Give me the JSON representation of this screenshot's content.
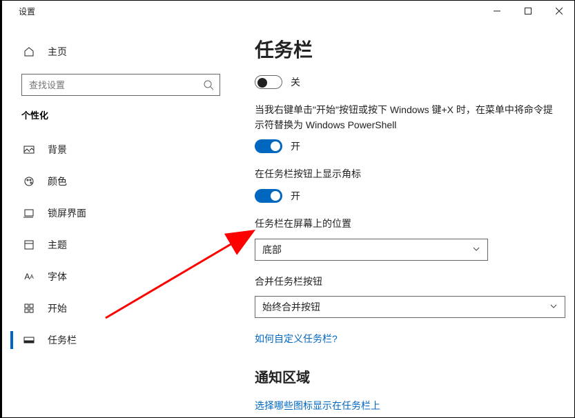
{
  "window": {
    "title": "设置"
  },
  "nav": {
    "home": "主页",
    "search_placeholder": "查找设置",
    "section": "个性化",
    "items": [
      {
        "label": "背景"
      },
      {
        "label": "颜色"
      },
      {
        "label": "锁屏界面"
      },
      {
        "label": "主题"
      },
      {
        "label": "字体"
      },
      {
        "label": "开始"
      },
      {
        "label": "任务栏"
      }
    ]
  },
  "page": {
    "title": "任务栏",
    "toggle1": {
      "state": "off",
      "label": "关"
    },
    "desc1": "当我右键单击\"开始\"按钮或按下 Windows 键+X 时，在菜单中将命令提示符替换为 Windows PowerShell",
    "toggle2": {
      "state": "on",
      "label": "开"
    },
    "desc2": "在任务栏按钮上显示角标",
    "toggle3": {
      "state": "on",
      "label": "开"
    },
    "desc3": "任务栏在屏幕上的位置",
    "dropdown1": "底部",
    "desc4": "合并任务栏按钮",
    "dropdown2": "始终合并按钮",
    "link1": "如何自定义任务栏?",
    "subsection": "通知区域",
    "link2": "选择哪些图标显示在任务栏上"
  }
}
